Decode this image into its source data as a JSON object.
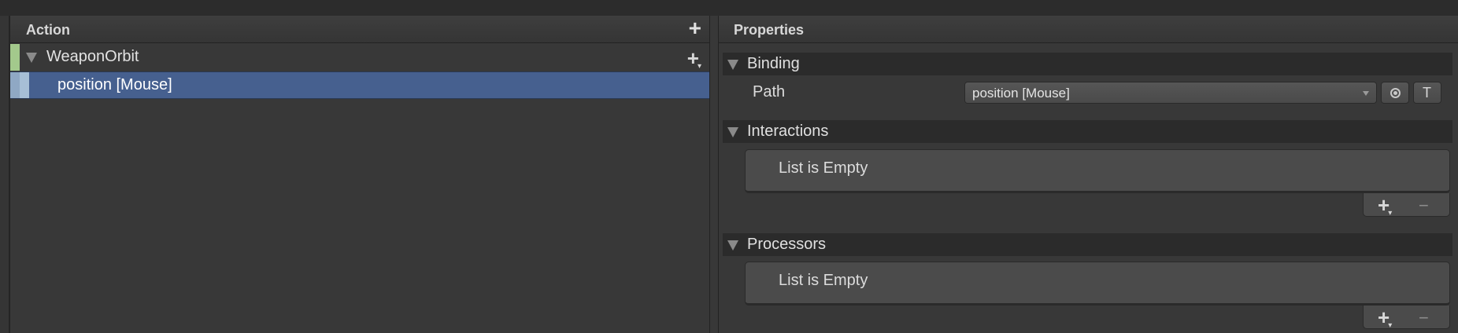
{
  "action_panel": {
    "title": "Action",
    "add_icon": "+",
    "action": {
      "label": "WeaponOrbit",
      "add_icon": "+",
      "add_dropdown_caret": "▾",
      "color": "#a3c98c"
    },
    "binding": {
      "label": "position [Mouse]"
    }
  },
  "properties_panel": {
    "title": "Properties",
    "binding_section": {
      "title": "Binding",
      "path_label": "Path",
      "path_value": "position [Mouse]",
      "listen_icon": "record-icon",
      "t_label": "T"
    },
    "interactions_section": {
      "title": "Interactions",
      "empty_text": "List is Empty",
      "add_icon": "+",
      "add_dropdown_caret": "▾",
      "remove_icon": "−"
    },
    "processors_section": {
      "title": "Processors",
      "empty_text": "List is Empty",
      "add_icon": "+",
      "add_dropdown_caret": "▾",
      "remove_icon": "−"
    }
  }
}
